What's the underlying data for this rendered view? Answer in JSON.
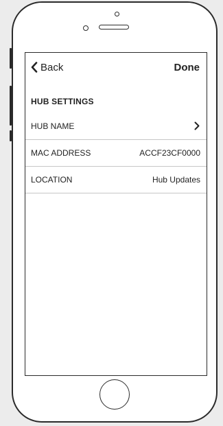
{
  "nav": {
    "back_label": "Back",
    "done_label": "Done",
    "back_icon": "chevron-left-icon"
  },
  "section": {
    "title": "HUB SETTINGS"
  },
  "rows": [
    {
      "label": "HUB NAME",
      "value": "",
      "icon": "chevron-right-icon"
    },
    {
      "label": "MAC ADDRESS",
      "value": "ACCF23CF0000"
    },
    {
      "label": "LOCATION",
      "value": "Hub Updates"
    }
  ],
  "colors": {
    "frame": "#2a2a2a",
    "background": "#ececec",
    "divider": "#c6c6c6",
    "text": "#222222"
  }
}
